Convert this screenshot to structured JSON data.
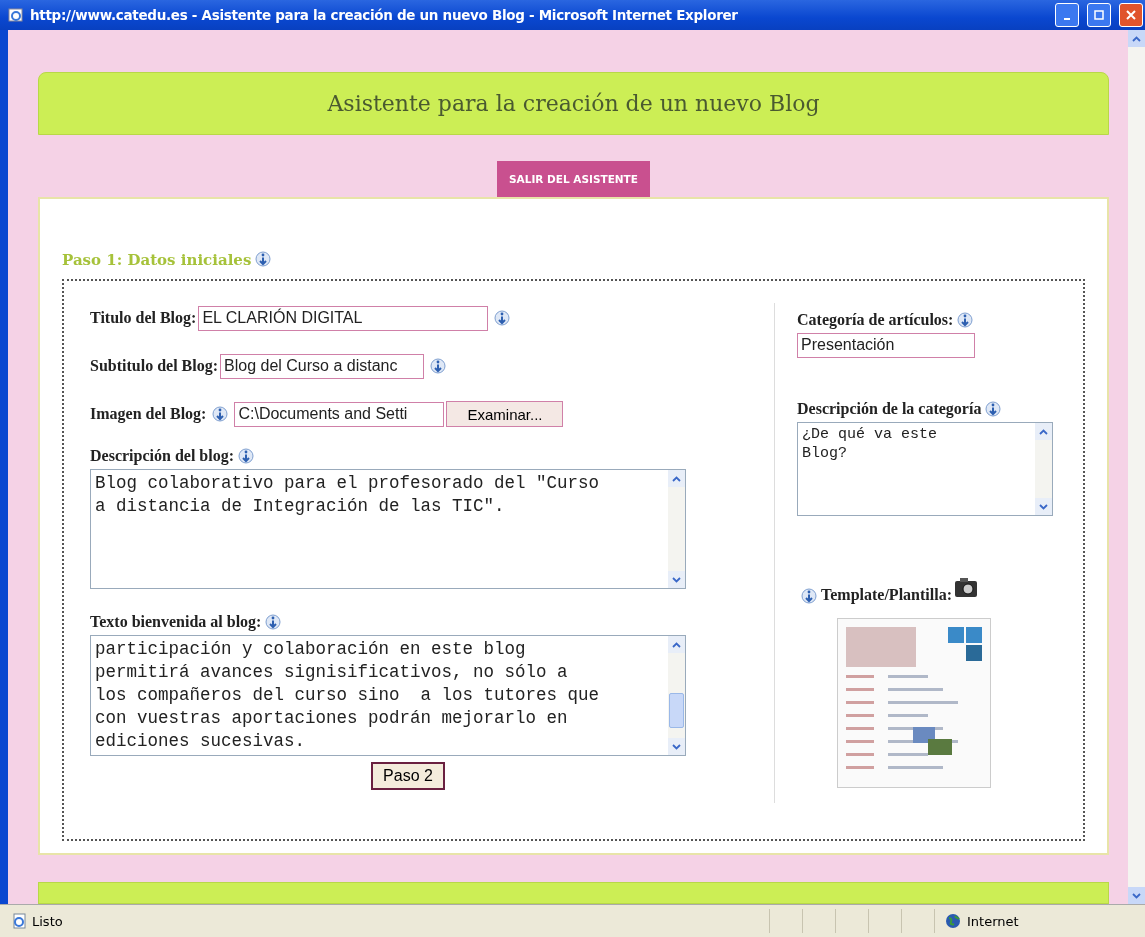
{
  "window": {
    "title": "http://www.catedu.es - Asistente para la creación de un nuevo Blog - Microsoft Internet Explorer"
  },
  "page": {
    "header_title": "Asistente para la creación de un nuevo Blog",
    "exit_button": "SALIR DEL ASISTENTE",
    "step_title": "Paso 1: Datos iniciales"
  },
  "form": {
    "title_field": {
      "label": "Titulo del Blog:",
      "value": "EL CLARIÓN DIGITAL"
    },
    "subtitle_field": {
      "label": "Subtitulo del Blog:",
      "value": "Blog del Curso a distanc"
    },
    "image_field": {
      "label": "Imagen del Blog:",
      "value": "C:\\Documents and Setti",
      "button": "Examinar..."
    },
    "description_field": {
      "label": "Descripción del blog:",
      "value": "Blog colaborativo para el profesorado del \"Curso\na distancia de Integración de las TIC\"."
    },
    "welcome_field": {
      "label": "Texto bienvenida al blog:",
      "value": "participación y colaboración en este blog\npermitirá avances signisificativos, no sólo a\nlos compañeros del curso sino  a los tutores que\ncon vuestras aportaciones podrán mejorarlo en\nediciones sucesivas."
    },
    "next_button": "Paso 2"
  },
  "sidebar": {
    "category_field": {
      "label": "Categoría de artículos:",
      "value": "Presentación"
    },
    "category_description": {
      "label": "Descripción de la categoría",
      "value": "¿De qué va este\nBlog?"
    },
    "template": {
      "label": "Template/Plantilla:"
    }
  },
  "status_bar": {
    "status": "Listo",
    "zone": "Internet"
  }
}
